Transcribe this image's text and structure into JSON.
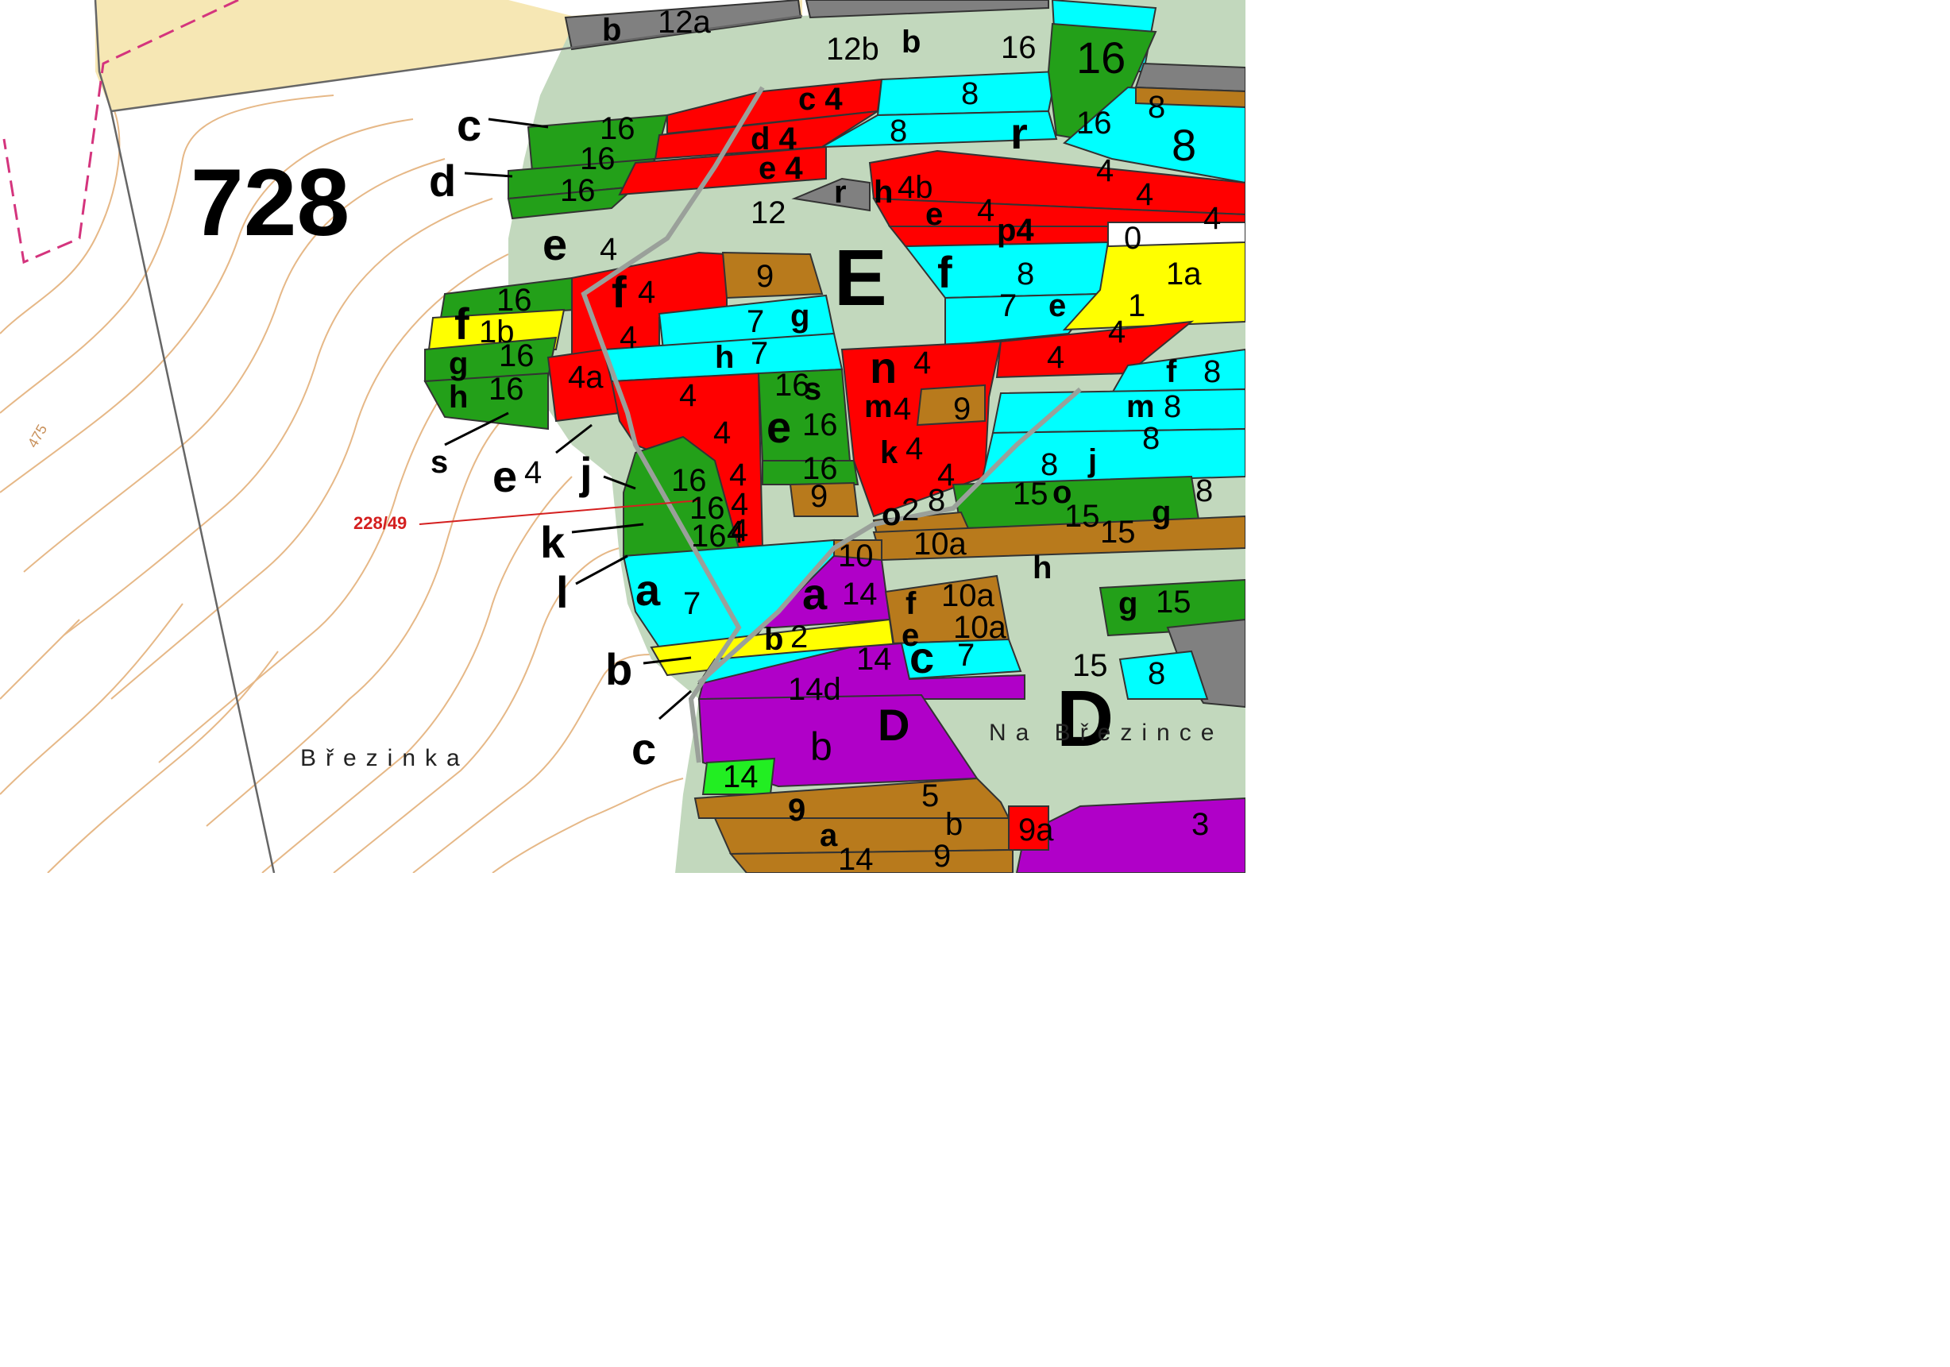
{
  "map": {
    "colors": {
      "background": "#ffffff",
      "light_green": "#c2d8bd",
      "tan": "#f6e7b4",
      "red": "#ff0000",
      "green": "#23a019",
      "cyan": "#00ffff",
      "brown": "#b87a1c",
      "yellow": "#ffff00",
      "purple": "#b000c8",
      "grey": "#808080",
      "bright_green": "#22ee22",
      "contour": "#e6b887",
      "boundary": "#666666",
      "dashed_pink": "#d4347d",
      "parcel_marker": "#d41f1f"
    },
    "compartment": "728",
    "block_E": "E",
    "block_D": "D",
    "place_brezinka": "Březinka",
    "place_na_brezince": "Na Březince",
    "contour_value": "475",
    "parcel_id": "228/49",
    "labels": [
      "12a",
      "b",
      "12b",
      "b",
      "16",
      "16",
      "c",
      "16",
      "c 4",
      "8",
      "8",
      "16",
      "8",
      "8",
      "r",
      "d 4",
      "16",
      "e 4",
      "4",
      "16",
      "12",
      "r",
      "h",
      "4b",
      "4",
      "e",
      "4",
      "4",
      "p4",
      "0",
      "d",
      "e",
      "4",
      "f",
      "8",
      "1a",
      "f",
      "16",
      "f",
      "4",
      "9",
      "7",
      "e",
      "1",
      "1b",
      "7",
      "g",
      "4",
      "4",
      "g",
      "16",
      "h",
      "7",
      "n",
      "4",
      "4",
      "f",
      "8",
      "h",
      "16",
      "4a",
      "4",
      "16",
      "s",
      "m",
      "4",
      "9",
      "m",
      "8",
      "e",
      "16",
      "4",
      "8",
      "s",
      "k",
      "4",
      "8",
      "j",
      "16",
      "4",
      "j",
      "4",
      "8",
      "e",
      "4",
      "16",
      "9",
      "4",
      "o",
      "2",
      "15",
      "o",
      "g",
      "8",
      "16",
      "4",
      "10",
      "10a",
      "15",
      "15",
      "k",
      "h",
      "16",
      "4",
      "a",
      "a",
      "14",
      "f",
      "10a",
      "g",
      "15",
      "l",
      "7",
      "e",
      "b",
      "2",
      "10a",
      "15",
      "b",
      "c",
      "7",
      "14",
      "8",
      "c",
      "14d",
      "D",
      "b",
      "14",
      "5",
      "9",
      "a",
      "b",
      "9a",
      "3",
      "14",
      "9",
      "3"
    ]
  }
}
